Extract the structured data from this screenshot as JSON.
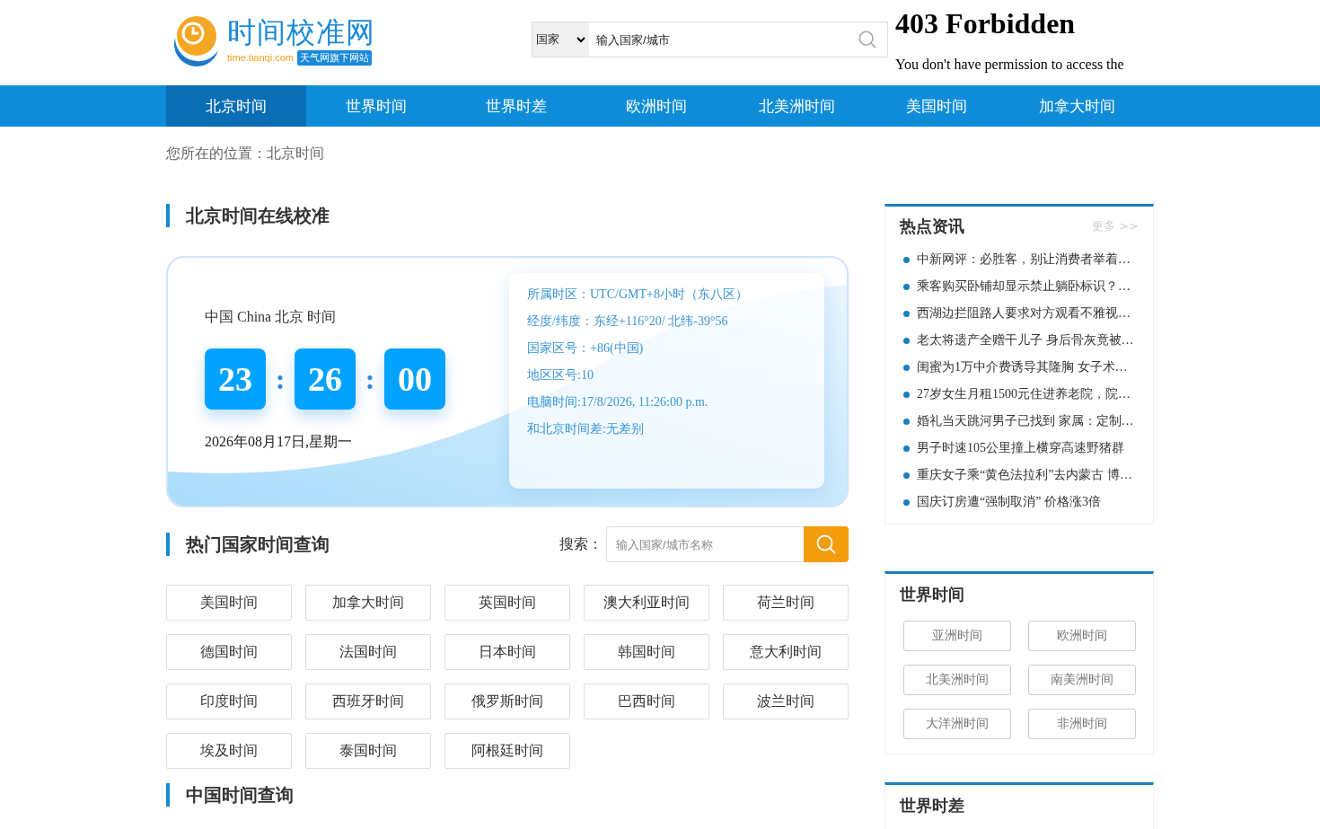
{
  "header": {
    "logo": {
      "name": "时间校准网",
      "domain": "time.tianqi.com",
      "tagline": "天气网旗下网站"
    },
    "search": {
      "select": "国家",
      "placeholder": "输入国家/城市"
    },
    "error_frame": {
      "title": "403 Forbidden",
      "message": "You don't have permission to access the"
    }
  },
  "nav": [
    {
      "label": "北京时间",
      "selected": true
    },
    {
      "label": "世界时间",
      "selected": false
    },
    {
      "label": "世界时差",
      "selected": false
    },
    {
      "label": "欧洲时间",
      "selected": false
    },
    {
      "label": "北美洲时间",
      "selected": false
    },
    {
      "label": "美国时间",
      "selected": false
    },
    {
      "label": "加拿大时间",
      "selected": false
    }
  ],
  "breadcrumb": "您所在的位置：北京时间",
  "clock_section": {
    "title": "北京时间在线校准",
    "location": "中国 China 北京 时间",
    "digits": [
      "23",
      "26",
      "00"
    ],
    "separators": [
      ":",
      ":"
    ],
    "date": "2026年08月17日,星期一",
    "info": [
      "所属时区：UTC/GMT+8小时（东八区）",
      "经度/纬度：东经+116°20/ 北纬-39°56",
      "国家区号：+86(中国)",
      "地区区号:10",
      "电脑时间:17/8/2026, 11:26:00 p.m.",
      "和北京时间差:无差别"
    ]
  },
  "hot_countries": {
    "title": "热门国家时间查询",
    "search_label": "搜索：",
    "search_placeholder": "输入国家/城市名称",
    "buttons": [
      "美国时间",
      "加拿大时间",
      "英国时间",
      "澳大利亚时间",
      "荷兰时间",
      "德国时间",
      "法国时间",
      "日本时间",
      "韩国时间",
      "意大利时间",
      "印度时间",
      "西班牙时间",
      "俄罗斯时间",
      "巴西时间",
      "波兰时间",
      "埃及时间",
      "泰国时间",
      "阿根廷时间"
    ]
  },
  "china_section": {
    "title": "中国时间查询"
  },
  "sidebar": {
    "news": {
      "title": "热点资讯",
      "more": "更多 >>",
      "items": [
        "中新网评：必胜客，别让消费者举着…",
        "乘客购买卧铺却显示禁止躺卧标识？…",
        "西湖边拦阻路人要求对方观看不雅视…",
        "老太将遗产全赠干儿子 身后骨灰竟被…",
        "闺蜜为1万中介费诱导其隆胸 女子术…",
        "27岁女生月租1500元住进养老院，院…",
        "婚礼当天跳河男子已找到 家属：定制…",
        "男子时速105公里撞上横穿高速野猪群",
        "重庆女子乘“黄色法拉利”去内蒙古 博…",
        "国庆订房遭“强制取消” 价格涨3倍"
      ]
    },
    "world_time": {
      "title": "世界时间",
      "buttons": [
        "亚洲时间",
        "欧洲时间",
        "北美洲时间",
        "南美洲时间",
        "大洋洲时间",
        "非洲时间"
      ]
    },
    "world_diff": {
      "title": "世界时差"
    }
  }
}
